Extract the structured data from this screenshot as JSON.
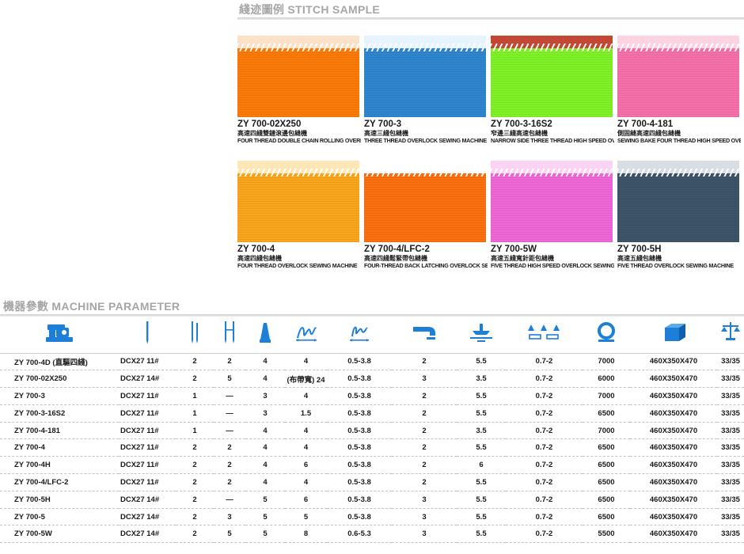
{
  "stitch_sample": {
    "title": "綫迹圖例 STITCH SAMPLE",
    "items": [
      {
        "model": "ZY 700-02X250",
        "cn": "高速四綫雙鏈滾邊包縫機",
        "en": "FOUR THREAD DOUBLE CHAIN ROLLING OVERLOCK SEWING MACHINE",
        "color": "#fb7a08",
        "edge_color": "#fbe1c7"
      },
      {
        "model": "ZY 700-3",
        "cn": "高速三綫包縫機",
        "en": "THREE THREAD OVERLOCK SEWING MACHINE",
        "color": "#2f86cf",
        "edge_color": "#e6f4ff"
      },
      {
        "model": "ZY 700-3-16S2",
        "cn": "窄邊三綫高速包縫機",
        "en": "NARROW SIDE THREE THREAD HIGH SPEED OVERLOCK SEWING MACHINE",
        "color": "#7ef226",
        "edge_color": "#c24735"
      },
      {
        "model": "ZY 700-4-181",
        "cn": "側固縫高速四綫包縫機",
        "en": "SEWING BAKE FOUR THREAD HIGH SPEED OVERLOCK SEWING MACHINE",
        "color": "#f570a8",
        "edge_color": "#fbd3e3"
      },
      {
        "model": "ZY 700-4",
        "cn": "高速四綫包縫機",
        "en": "FOUR THREAD OVERLOCK SEWING MACHINE",
        "color": "#f9a61c",
        "edge_color": "#fde7b6"
      },
      {
        "model": "ZY 700-4/LFC-2",
        "cn": "高速四綫鬆緊帶包縫機",
        "en": "FOUR-THREAD BACK LATCHING OVERLOCK SEWING MACHINE",
        "color": "#fb6f10",
        "edge_color": "#ffffff"
      },
      {
        "model": "ZY 700-5W",
        "cn": "高速五綫寬針距包縫機",
        "en": "FIVE THREAD HIGH SPEED OVERLOCK SEWING MACHINE",
        "color": "#ef66d6",
        "edge_color": "#fbd4f3"
      },
      {
        "model": "ZY 700-5H",
        "cn": "高速五綫包縫機",
        "en": "FIVE THREAD OVERLOCK SEWING MACHINE",
        "color": "#3e5468",
        "edge_color": "#d9dde4"
      }
    ]
  },
  "machine_parameter": {
    "title": "機器參數 MACHINE PARAMETER",
    "header_icons": [
      "sewing-machine-icon",
      "needle-icon",
      "needle-count-icon",
      "needle-distance-icon",
      "thread-cone-icon",
      "stitch-width-icon",
      "stitch-length-icon",
      "differential-ratio-icon",
      "presser-lift-icon",
      "max-speed-icon",
      "dimension-box-icon",
      "weight-scale-icon"
    ],
    "accent_color": "#1e7fd8",
    "rows": [
      [
        "ZY 700-4D (直驅四綫)",
        "DCX27 11#",
        "2",
        "2",
        "4",
        "4",
        "0.5-3.8",
        "2",
        "5.5",
        "0.7-2",
        "7000",
        "460X350X470",
        "33/35"
      ],
      [
        "ZY 700-02X250",
        "DCX27 14#",
        "2",
        "5",
        "4",
        "(布帶寬) 24",
        "0.5-3.8",
        "3",
        "3.5",
        "0.7-2",
        "6000",
        "460X350X470",
        "33/35"
      ],
      [
        "ZY 700-3",
        "DCX27 11#",
        "1",
        "—",
        "3",
        "4",
        "0.5-3.8",
        "2",
        "5.5",
        "0.7-2",
        "7000",
        "460X350X470",
        "33/35"
      ],
      [
        "ZY 700-3-16S2",
        "DCX27 11#",
        "1",
        "—",
        "3",
        "1.5",
        "0.5-3.8",
        "2",
        "5.5",
        "0.7-2",
        "6500",
        "460X350X470",
        "33/35"
      ],
      [
        "ZY 700-4-181",
        "DCX27 11#",
        "1",
        "—",
        "4",
        "4",
        "0.5-3.8",
        "2",
        "3.5",
        "0.7-2",
        "7000",
        "460X350X470",
        "33/35"
      ],
      [
        "ZY 700-4",
        "DCX27 11#",
        "2",
        "2",
        "4",
        "4",
        "0.5-3.8",
        "2",
        "5.5",
        "0.7-2",
        "6500",
        "460X350X470",
        "33/35"
      ],
      [
        "ZY 700-4H",
        "DCX27 11#",
        "2",
        "2",
        "4",
        "6",
        "0.5-3.8",
        "2",
        "6",
        "0.7-2",
        "6500",
        "460X350X470",
        "33/35"
      ],
      [
        "ZY 700-4/LFC-2",
        "DCX27 11#",
        "2",
        "2",
        "4",
        "4",
        "0.5-3.8",
        "2",
        "5.5",
        "0.7-2",
        "6500",
        "460X350X470",
        "33/35"
      ],
      [
        "ZY 700-5H",
        "DCX27 14#",
        "2",
        "—",
        "5",
        "6",
        "0.5-3.8",
        "3",
        "5.5",
        "0.7-2",
        "6500",
        "460X350X470",
        "33/35"
      ],
      [
        "ZY 700-5",
        "DCX27 14#",
        "2",
        "3",
        "5",
        "5",
        "0.5-3.8",
        "3",
        "5.5",
        "0.7-2",
        "6500",
        "460X350X470",
        "33/35"
      ],
      [
        "ZY 700-5W",
        "DCX27 14#",
        "2",
        "5",
        "5",
        "8",
        "0.6-5.3",
        "3",
        "5.5",
        "0.7-2",
        "5500",
        "460X350X470",
        "33/35"
      ]
    ]
  }
}
